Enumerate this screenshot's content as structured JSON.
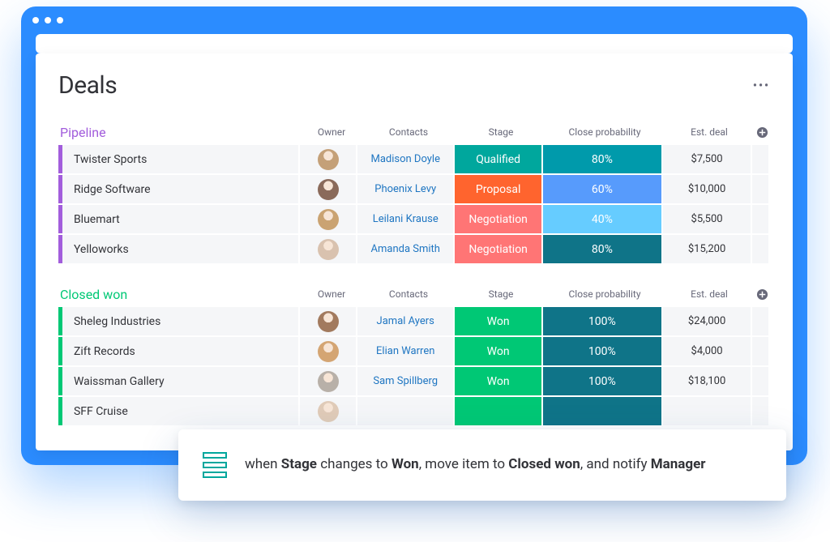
{
  "page_title": "Deals",
  "columns": {
    "owner": "Owner",
    "contacts": "Contacts",
    "stage": "Stage",
    "probability": "Close probability",
    "est_deal": "Est. deal"
  },
  "groups": [
    {
      "key": "pipeline",
      "name": "Pipeline",
      "rows": [
        {
          "name": "Twister Sports",
          "avatar_bg": "#c4a078",
          "contact": "Madison Doyle",
          "stage": "Qualified",
          "stage_class": "c-qualified",
          "probability": "80%",
          "prob_class": "c-teal",
          "est_deal": "$7,500"
        },
        {
          "name": "Ridge Software",
          "avatar_bg": "#8a6a5a",
          "contact": "Phoenix Levy",
          "stage": "Proposal",
          "stage_class": "c-proposal",
          "probability": "60%",
          "prob_class": "c-blue",
          "est_deal": "$10,000"
        },
        {
          "name": "Bluemart",
          "avatar_bg": "#caa372",
          "contact": "Leilani Krause",
          "stage": "Negotiation",
          "stage_class": "c-negotiation",
          "probability": "40%",
          "prob_class": "c-lteal",
          "est_deal": "$5,500"
        },
        {
          "name": "Yelloworks",
          "avatar_bg": "#d9c2af",
          "contact": "Amanda Smith",
          "stage": "Negotiation",
          "stage_class": "c-negotiation",
          "probability": "80%",
          "prob_class": "c-dteal",
          "est_deal": "$15,200"
        }
      ]
    },
    {
      "key": "closedwon",
      "name": "Closed won",
      "rows": [
        {
          "name": "Sheleg Industries",
          "avatar_bg": "#a27a5e",
          "contact": "Jamal Ayers",
          "stage": "Won",
          "stage_class": "c-won",
          "probability": "100%",
          "prob_class": "c-dteal",
          "est_deal": "$24,000"
        },
        {
          "name": "Zift Records",
          "avatar_bg": "#d4a573",
          "contact": "Elian Warren",
          "stage": "Won",
          "stage_class": "c-won",
          "probability": "100%",
          "prob_class": "c-dteal",
          "est_deal": "$4,000"
        },
        {
          "name": "Waissman Gallery",
          "avatar_bg": "#b8b0a8",
          "contact": "Sam Spillberg",
          "stage": "Won",
          "stage_class": "c-won",
          "probability": "100%",
          "prob_class": "c-dteal",
          "est_deal": "$18,100"
        },
        {
          "name": "SFF Cruise",
          "avatar_bg": "#e0cbb8",
          "contact": "",
          "stage": "",
          "stage_class": "c-won",
          "probability": "",
          "prob_class": "c-dteal",
          "est_deal": ""
        }
      ]
    }
  ],
  "automation": {
    "parts": [
      "when ",
      "Stage",
      " changes to ",
      "Won",
      ", move item to ",
      "Closed won",
      ", and notify ",
      "Manager"
    ]
  }
}
